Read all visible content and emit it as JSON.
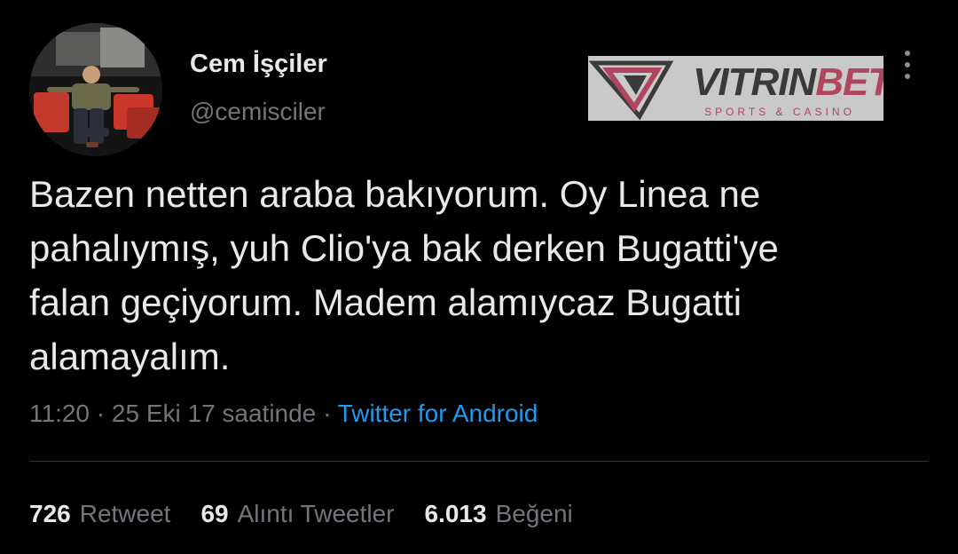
{
  "user": {
    "display_name": "Cem İşçiler",
    "handle": "@cemisciler"
  },
  "tweet": {
    "lines": [
      "Bazen netten araba bakıyorum. Oy Linea ne",
      "pahalıymış, yuh Clio'ya bak derken Bugatti'ye",
      "falan geçiyorum. Madem alamıycaz Bugatti",
      "alamayalım."
    ],
    "time": "11:20",
    "sep1": "·",
    "date": "25 Eki 17 saatinde",
    "sep2": "·",
    "source": "Twitter for Android"
  },
  "stats": [
    {
      "count": "726",
      "label": "Retweet"
    },
    {
      "count": "69",
      "label": "Alıntı Tweetler"
    },
    {
      "count": "6.013",
      "label": "Beğeni"
    }
  ],
  "watermark": {
    "brand_part1": "VITRIN",
    "brand_part2": "BET",
    "tagline": "SPORTS & CASINO"
  },
  "icons": {
    "more": "more-vertical-icon"
  },
  "colors": {
    "background": "#000000",
    "text": "#e7e9ea",
    "secondary": "#71767b",
    "link": "#1d9bf0",
    "divider": "#2f3336",
    "watermark_accent": "#b0455e"
  }
}
